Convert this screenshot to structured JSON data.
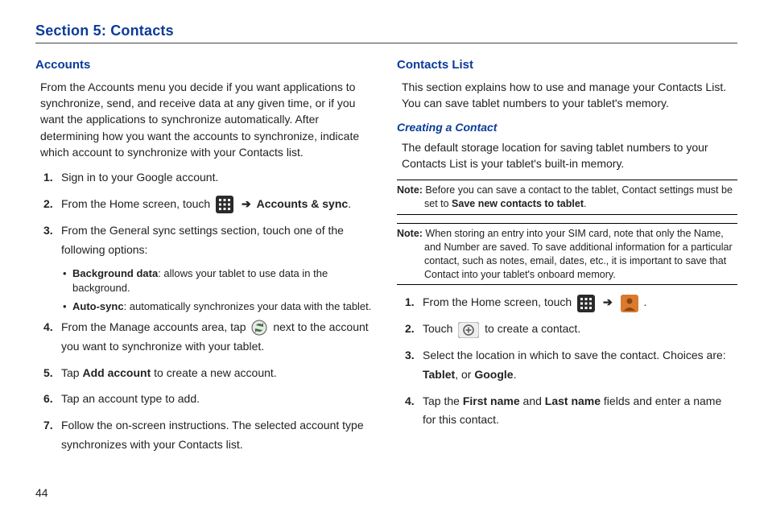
{
  "page_number": "44",
  "title": "Section 5: Contacts",
  "left": {
    "heading": "Accounts",
    "intro": "From the Accounts menu you decide if you want applications to synchronize, send, and receive data at any given time, or if you want the applications to synchronize automatically. After determining how you want the accounts to synchronize, indicate which account to synchronize with your Contacts list.",
    "step1": "Sign in to your Google account.",
    "step2_pre": "From the Home screen, touch ",
    "step2_arrow": "➔",
    "step2_post": "Accounts & sync",
    "step2_end": ".",
    "step3": "From the General sync settings section, touch one of the following options:",
    "bullet1_label": "Background data",
    "bullet1_text": ": allows your tablet to use data in the background.",
    "bullet2_label": "Auto-sync",
    "bullet2_text": ": automatically synchronizes your data with the tablet.",
    "step4_pre": "From the Manage accounts area, tap ",
    "step4_post": " next to the account you want to synchronize with your tablet.",
    "step5_pre": "Tap ",
    "step5_bold": "Add account",
    "step5_post": " to create a new account.",
    "step6": "Tap an account type to add.",
    "step7": "Follow the on-screen instructions. The selected account type synchronizes with your Contacts list."
  },
  "right": {
    "heading": "Contacts List",
    "intro": "This section explains how to use and manage your Contacts List. You can save tablet numbers to your tablet's memory.",
    "sub": "Creating a Contact",
    "body": "The default storage location for saving tablet numbers to your Contacts List is your tablet's built-in memory.",
    "note1_label": "Note:",
    "note1_pre": " Before you can save a contact to the tablet, Contact settings must be set to ",
    "note1_bold": "Save new contacts to tablet",
    "note1_end": ".",
    "note2_label": "Note:",
    "note2_text": " When storing an entry into your SIM card, note that only the Name, and Number are saved. To save additional information for a particular contact, such as notes, email, dates, etc., it is important to save that Contact into your tablet's onboard memory.",
    "step1_pre": "From the Home screen, touch ",
    "step1_arrow": "➔",
    "step1_end": " .",
    "step2_pre": "Touch ",
    "step2_post": " to create a contact.",
    "step3_pre": "Select the location in which to save the contact. Choices are: ",
    "step3_b1": "Tablet",
    "step3_mid": ", or ",
    "step3_b2": "Google",
    "step3_end": ".",
    "step4_pre": "Tap the ",
    "step4_b1": "First name",
    "step4_mid": " and ",
    "step4_b2": "Last name",
    "step4_post": " fields and enter a name for this contact."
  },
  "icons": {
    "apps": "apps-grid-icon",
    "sync": "sync-icon",
    "contact": "contact-person-icon",
    "add": "add-plus-icon"
  }
}
